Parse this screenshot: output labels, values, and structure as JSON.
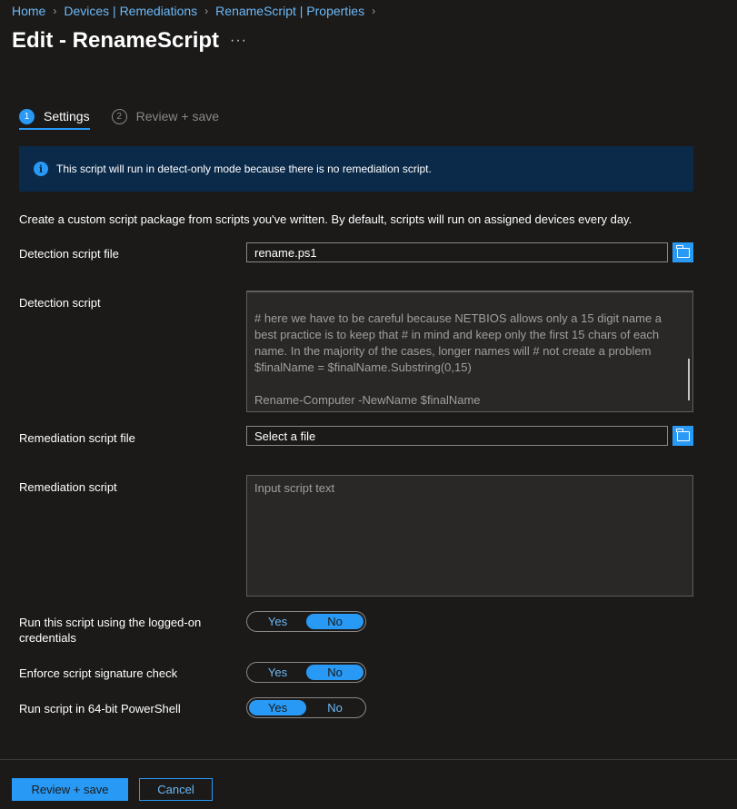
{
  "breadcrumb": [
    {
      "label": "Home"
    },
    {
      "label": "Devices | Remediations"
    },
    {
      "label": "RenameScript | Properties"
    }
  ],
  "page": {
    "title": "Edit - RenameScript",
    "more": "···"
  },
  "wizard": {
    "steps": [
      {
        "number": "1",
        "label": "Settings"
      },
      {
        "number": "2",
        "label": "Review + save"
      }
    ]
  },
  "banner": {
    "icon": "info-icon",
    "text": "This script will run in detect-only mode because there is no remediation script."
  },
  "description": "Create a custom script package from scripts you've written. By default, scripts will run on assigned devices every day.",
  "detection": {
    "file_label": "Detection script file",
    "file_value": "rename.ps1",
    "script_label": "Detection script",
    "script_lines": [
      "# here we have to be careful because NETBIOS allows only a 15 digit name a best practice is to keep that # in mind and keep only the first 15 chars of each name. In the majority of the cases, longer names will # not create a problem $finalName = $finalName.Substring(0,15)",
      "",
      "Rename-Computer -NewName $finalName"
    ]
  },
  "remediation": {
    "file_label": "Remediation script file",
    "file_value": "Select a file",
    "script_label": "Remediation script",
    "script_placeholder": "Input script text"
  },
  "options": [
    {
      "label": "Run this script using the logged-on credentials",
      "yes": "Yes",
      "no": "No",
      "selected": "No"
    },
    {
      "label": "Enforce script signature check",
      "yes": "Yes",
      "no": "No",
      "selected": "No"
    },
    {
      "label": "Run script in 64-bit PowerShell",
      "yes": "Yes",
      "no": "No",
      "selected": "Yes"
    }
  ],
  "footer": {
    "review_label": "Review + save",
    "cancel_label": "Cancel"
  },
  "colors": {
    "accent": "#2899f5",
    "background": "#1b1a19",
    "banner": "#0b2a4a"
  }
}
